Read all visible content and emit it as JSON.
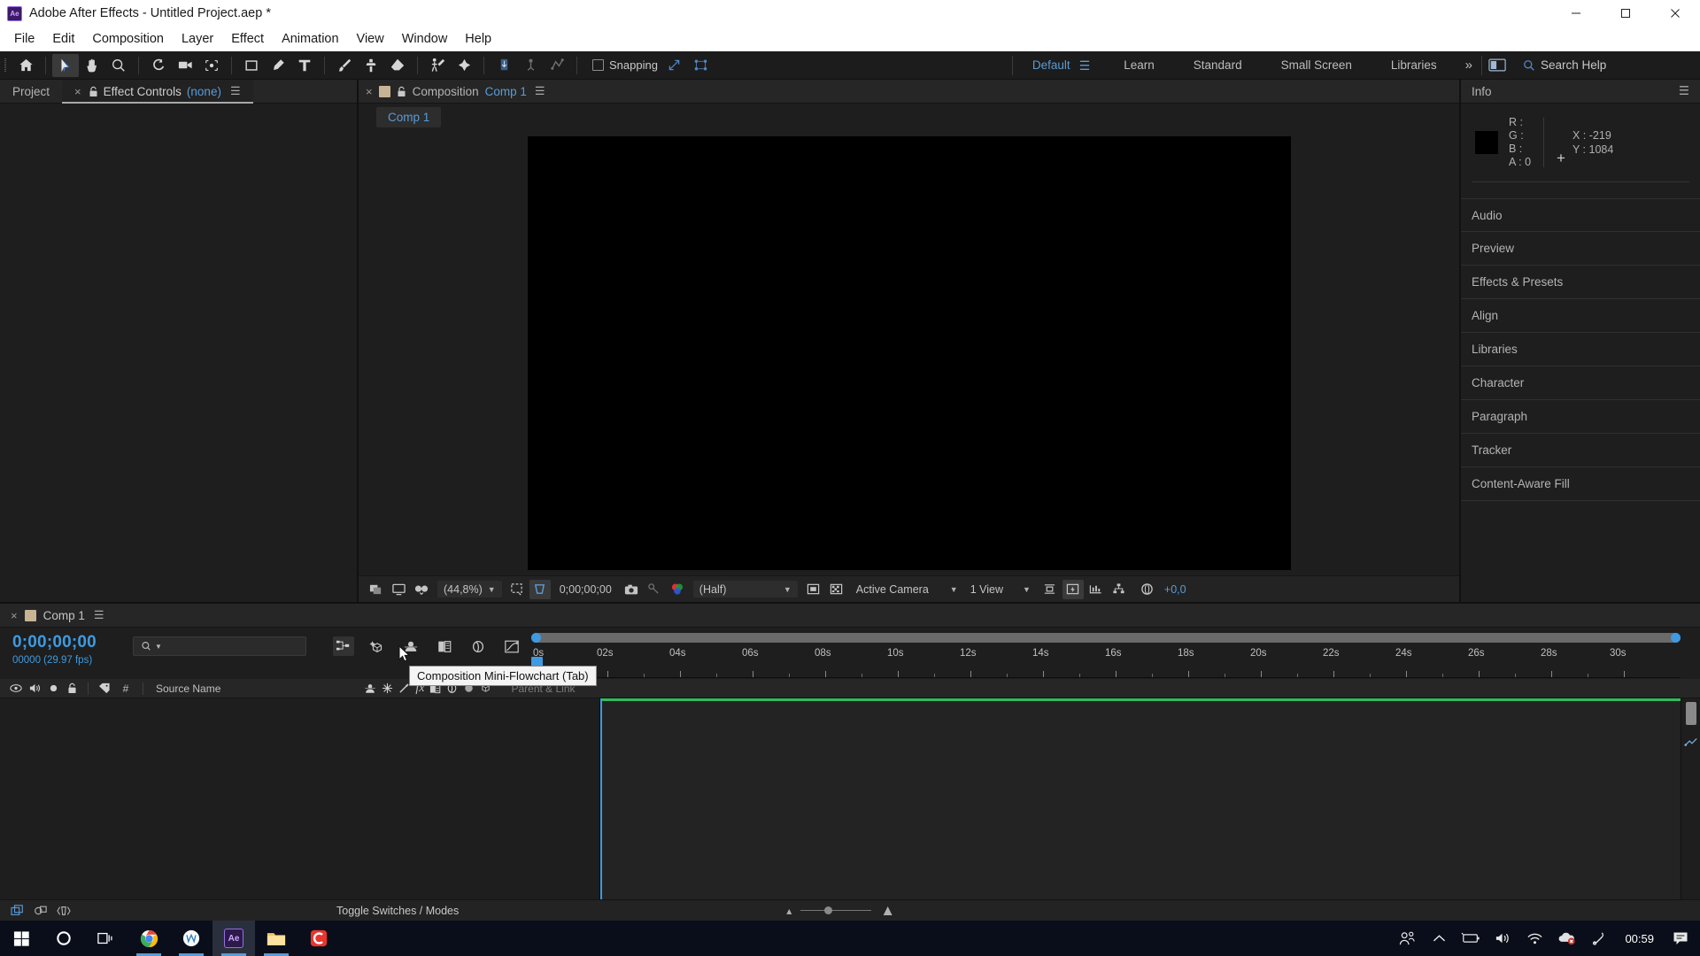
{
  "window": {
    "app_icon": "ae-logo",
    "title": "Adobe After Effects - Untitled Project.aep *",
    "minimize": "minimize-button",
    "maximize": "maximize-button",
    "close": "close-button"
  },
  "menubar": {
    "items": [
      "File",
      "Edit",
      "Composition",
      "Layer",
      "Effect",
      "Animation",
      "View",
      "Window",
      "Help"
    ]
  },
  "toolbar": {
    "tools": [
      {
        "name": "home-icon",
        "active": false
      },
      {
        "name": "selection-tool-icon",
        "active": true
      },
      {
        "name": "hand-tool-icon",
        "active": false
      },
      {
        "name": "zoom-tool-icon",
        "active": false
      },
      {
        "name": "rotation-tool-icon",
        "active": false
      },
      {
        "name": "camera-tool-icon",
        "active": false
      },
      {
        "name": "pan-behind-tool-icon",
        "active": false
      },
      {
        "name": "shape-tool-icon",
        "active": false
      },
      {
        "name": "pen-tool-icon",
        "active": false
      },
      {
        "name": "type-tool-icon",
        "active": false
      },
      {
        "name": "brush-tool-icon",
        "active": false
      },
      {
        "name": "clone-stamp-tool-icon",
        "active": false
      },
      {
        "name": "eraser-tool-icon",
        "active": false
      },
      {
        "name": "roto-brush-tool-icon",
        "active": false
      },
      {
        "name": "puppet-pin-tool-icon",
        "active": false
      },
      {
        "name": "unified-camera-icon",
        "active": false
      },
      {
        "name": "orbit-tool-icon",
        "active": false
      },
      {
        "name": "track-xy-tool-icon",
        "active": false
      }
    ],
    "snapping_label": "Snapping",
    "snapping_checked": false,
    "extra_icons": [
      "snap-expand-icon",
      "snap-grid-icon"
    ],
    "workspaces": [
      {
        "label": "Default",
        "active": true
      },
      {
        "label": "Learn",
        "active": false
      },
      {
        "label": "Standard",
        "active": false
      },
      {
        "label": "Small Screen",
        "active": false
      },
      {
        "label": "Libraries",
        "active": false
      }
    ],
    "workspace_overflow": "»",
    "search_placeholder": "Search Help",
    "search_value": ""
  },
  "left_panel": {
    "tabs": [
      {
        "label": "Project",
        "active": false,
        "closable": false
      },
      {
        "label": "Effect Controls",
        "suffix": "(none)",
        "active": true,
        "closable": true,
        "locked": true
      }
    ],
    "menu_icon": "panel-menu-icon"
  },
  "comp_panel": {
    "tab": {
      "close": "×",
      "swatch_color": "#c8b394",
      "lock_icon": "lock-icon",
      "label": "Composition",
      "comp_name": "Comp 1",
      "menu_icon": "panel-menu-icon"
    },
    "subtab": "Comp 1",
    "canvas_color": "#000000",
    "bottom_bar": {
      "zoom": "(44,8%)",
      "timecode": "0;00;00;00",
      "resolution": "(Half)",
      "camera": "Active Camera",
      "views": "1 View",
      "exposure": "+0,0",
      "icons": [
        "always-preview-icon",
        "main-viewer-icon",
        "3d-glasses-icon",
        "region-of-interest-icon",
        "transparency-grid-icon",
        "snapshot-icon",
        "show-snapshot-icon",
        "channel-icon",
        "mask-icon",
        "checkerboard-icon",
        "guides-icon",
        "fast-preview-icon",
        "timeline-icon",
        "flowchart-icon",
        "exposure-icon"
      ]
    }
  },
  "right_panel": {
    "info": {
      "title": "Info",
      "menu_icon": "panel-menu-icon",
      "swatch_color": "#000000",
      "channels": [
        {
          "label": "R :",
          "value": ""
        },
        {
          "label": "G :",
          "value": ""
        },
        {
          "label": "B :",
          "value": ""
        },
        {
          "label": "A :",
          "value": "0"
        }
      ],
      "coords": [
        {
          "label": "X :",
          "value": "-219"
        },
        {
          "label": "Y :",
          "value": "1084"
        }
      ]
    },
    "panels": [
      "Audio",
      "Preview",
      "Effects & Presets",
      "Align",
      "Libraries",
      "Character",
      "Paragraph",
      "Tracker",
      "Content-Aware Fill"
    ]
  },
  "timeline": {
    "tab": {
      "close": "×",
      "swatch_color": "#c8b394",
      "name": "Comp 1",
      "menu_icon": "panel-menu-icon"
    },
    "current_time": "0;00;00;00",
    "frames": "00000 (29.97 fps)",
    "search_placeholder": "",
    "search_value": "",
    "toolbar_icons": [
      "composition-mini-flowchart-icon",
      "draft-3d-icon",
      "hide-shy-layers-icon",
      "frame-blending-icon",
      "motion-blur-icon",
      "graph-editor-icon"
    ],
    "tooltip": "Composition Mini-Flowchart (Tab)",
    "column_headers": {
      "icons": [
        "eye-icon",
        "audio-icon",
        "solo-icon",
        "lock-icon",
        "label-icon"
      ],
      "hash": "#",
      "source_name": "Source Name",
      "switches": [
        "shy-icon",
        "collapse-icon",
        "quality-icon",
        "fx-icon",
        "frame-blend-icon",
        "motion-blur-icon",
        "adjustment-icon",
        "3d-icon"
      ],
      "parent_and_link": "Parent & Link"
    },
    "ruler_ticks": [
      "02s",
      "04s",
      "06s",
      "08s",
      "10s",
      "12s",
      "14s",
      "16s",
      "18s",
      "20s",
      "22s",
      "24s",
      "26s",
      "28s",
      "30s"
    ],
    "ruler_start": "0s",
    "duration_seconds": 30,
    "bottom_bar": {
      "icons": [
        "toggle-switches-icon",
        "transfer-controls-icon",
        "stretch-icon"
      ],
      "toggle_label": "Toggle Switches / Modes",
      "zoom_icons": [
        "zoom-out-icon",
        "zoom-in-icon"
      ]
    },
    "colors": {
      "playhead": "#3f9ae0",
      "work_area_bar": "#2fbd5a"
    }
  },
  "taskbar": {
    "items": [
      {
        "name": "start-button",
        "icon": "windows-logo-icon",
        "active": false
      },
      {
        "name": "cortana-button",
        "icon": "cortana-circle-icon",
        "active": false
      },
      {
        "name": "task-view-button",
        "icon": "task-view-icon",
        "active": false
      },
      {
        "name": "chrome-button",
        "icon": "chrome-icon",
        "active": false,
        "running": true
      },
      {
        "name": "app-w-button",
        "icon": "w-circle-icon",
        "active": false,
        "running": true
      },
      {
        "name": "after-effects-button",
        "icon": "ae-icon",
        "active": true,
        "running": true
      },
      {
        "name": "file-explorer-button",
        "icon": "folder-icon",
        "active": false,
        "running": true
      },
      {
        "name": "camtasia-button",
        "icon": "c-icon",
        "active": false,
        "running": false
      }
    ],
    "tray": [
      "people-icon",
      "show-hidden-icons-icon",
      "battery-icon",
      "volume-icon",
      "wifi-icon",
      "onedrive-error-icon",
      "pen-icon"
    ],
    "clock": "00:59",
    "notifications": "notification-icon"
  }
}
